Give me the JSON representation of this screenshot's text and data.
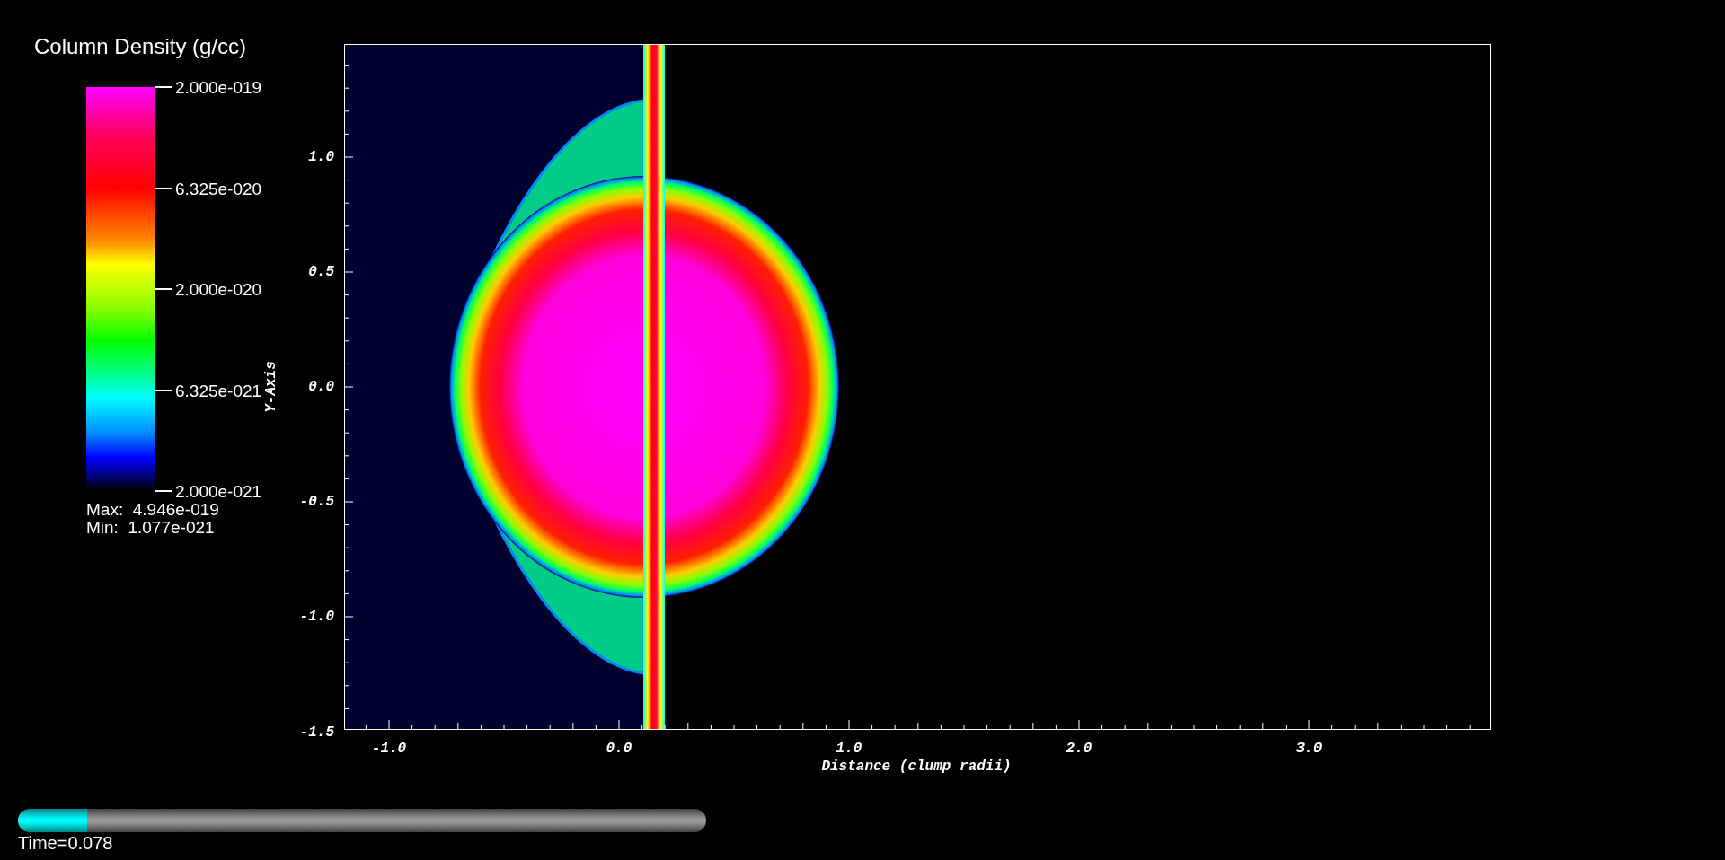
{
  "legend": {
    "title": "Column Density (g/cc)",
    "labels": [
      "2.000e-019",
      "6.325e-020",
      "2.000e-020",
      "6.325e-021",
      "2.000e-021"
    ],
    "max": "Max:  4.946e-019",
    "min": "Min:  1.077e-021"
  },
  "plot": {
    "y_axis": {
      "title": "Y-Axis",
      "ticks": [
        "1.0",
        "0.5",
        "0.0",
        "-0.5",
        "-1.0",
        "-1.5"
      ]
    },
    "x_axis": {
      "title": "Distance (clump radii)",
      "ticks": [
        "-1.0",
        "0.0",
        "1.0",
        "2.0",
        "3.0"
      ]
    }
  },
  "time_slider": {
    "level": 0.1,
    "label": "Time=0.078"
  }
}
